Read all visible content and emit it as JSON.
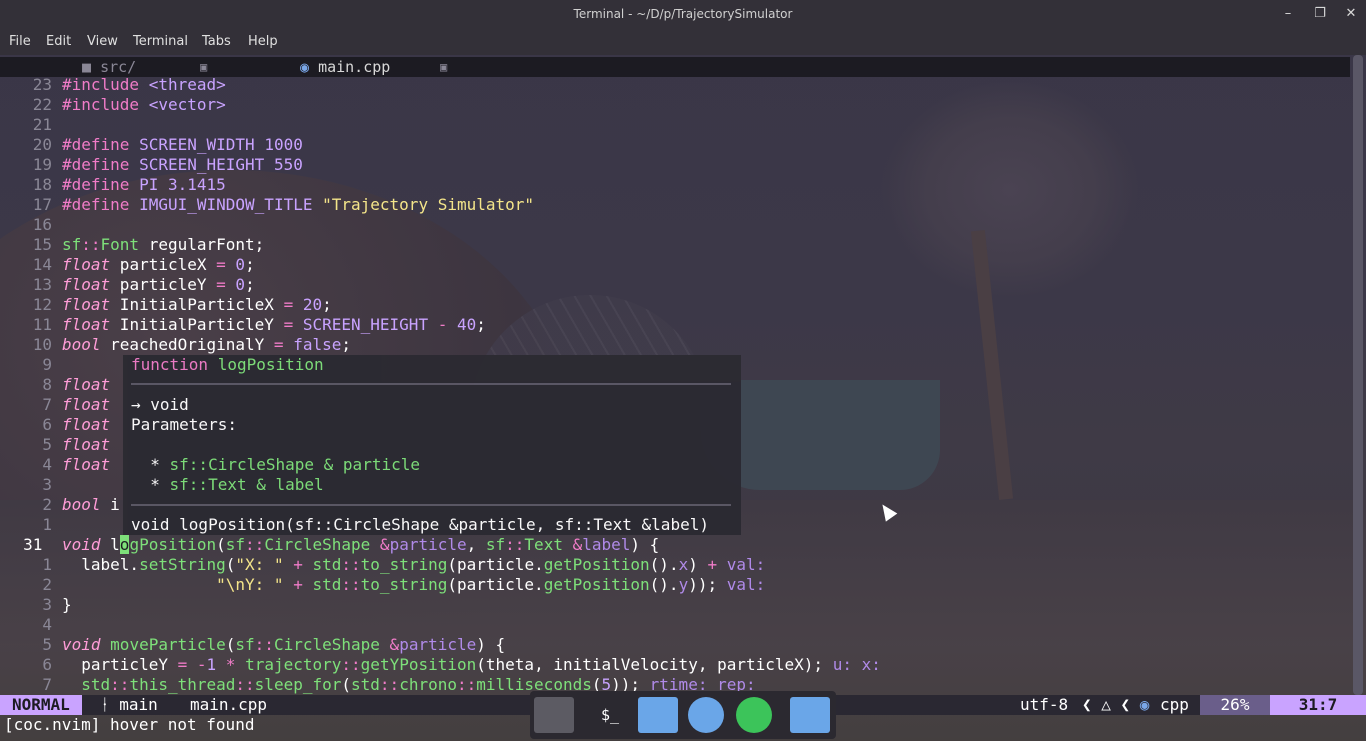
{
  "window": {
    "title": "Terminal - ~/D/p/TrajectorySimulator"
  },
  "menu": [
    "File",
    "Edit",
    "View",
    "Terminal",
    "Tabs",
    "Help"
  ],
  "tabs": {
    "src_label": "src/",
    "file_label": "main.cpp"
  },
  "hover": {
    "sig_kind": "function",
    "sig_name": "logPosition",
    "returns": "→ void",
    "params_title": "Parameters:",
    "param1": "sf::CircleShape & particle",
    "param2": "sf::Text & label",
    "decl": "void logPosition(sf::CircleShape &particle, sf::Text &label)"
  },
  "statusline": {
    "mode": "NORMAL",
    "branch": "main",
    "file": "main.cpp",
    "encoding": "utf-8",
    "filetype": "cpp",
    "percent": "26%",
    "position": "31:7"
  },
  "cmdline": "[coc.nvim] hover not found",
  "colors": {
    "accent": "#c9a3ff",
    "keyword": "#f07cc8",
    "function": "#7ee07a",
    "string": "#f4e58a"
  }
}
